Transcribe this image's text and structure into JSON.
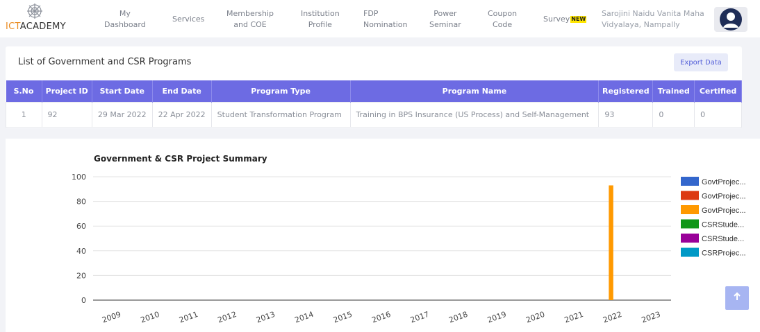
{
  "header": {
    "logo_text": "ICTACADEMY",
    "logo_prefix": "ICT",
    "logo_suffix": "ACADEMY",
    "nav": [
      {
        "label": "My\nDashboard"
      },
      {
        "label": "Services"
      },
      {
        "label": "Membership\nand COE"
      },
      {
        "label": "Institution\nProfile"
      },
      {
        "label": "FDP\nNomination"
      },
      {
        "label": "Power\nSeminar"
      },
      {
        "label": "Coupon\nCode"
      },
      {
        "label": "Survey",
        "badge": "NEW"
      }
    ],
    "college": "Sarojini Naidu Vanita Maha\nVidyalaya, Nampally",
    "avatar_icon": "user-circle-icon"
  },
  "programs": {
    "title": "List of Government and CSR Programs",
    "export_label": "Export Data",
    "columns": [
      "S.No",
      "Project ID",
      "Start Date",
      "End Date",
      "Program Type",
      "Program Name",
      "Registered",
      "Trained",
      "Certified"
    ],
    "rows": [
      [
        "1",
        "92",
        "29 Mar 2022",
        "22 Apr 2022",
        "Student Transformation Program",
        "Training in BPS Insurance (US Process) and Self-Management",
        "93",
        "0",
        "0"
      ]
    ],
    "header_color": "#6d6be3"
  },
  "chart_data": {
    "type": "bar",
    "title": "Government & CSR Project Summary",
    "categories": [
      "2009",
      "2010",
      "2011",
      "2012",
      "2013",
      "2014",
      "2015",
      "2016",
      "2017",
      "2018",
      "2019",
      "2020",
      "2021",
      "2022",
      "2023"
    ],
    "ylim": [
      0,
      100
    ],
    "yticks": [
      0,
      20,
      40,
      60,
      80,
      100
    ],
    "grid": true,
    "legend_position": "right",
    "series": [
      {
        "name": "GovtProjec...",
        "color": "#3366cc",
        "values": [
          0,
          0,
          0,
          0,
          0,
          0,
          0,
          0,
          0,
          0,
          0,
          0,
          0,
          0,
          0
        ]
      },
      {
        "name": "GovtProjec...",
        "color": "#dc3912",
        "values": [
          0,
          0,
          0,
          0,
          0,
          0,
          0,
          0,
          0,
          0,
          0,
          0,
          0,
          0,
          0
        ]
      },
      {
        "name": "GovtProjec...",
        "color": "#ff9900",
        "values": [
          0,
          0,
          0,
          0,
          0,
          0,
          0,
          0,
          0,
          0,
          0,
          0,
          0,
          93,
          0
        ]
      },
      {
        "name": "CSRStude...",
        "color": "#109618",
        "values": [
          0,
          0,
          0,
          0,
          0,
          0,
          0,
          0,
          0,
          0,
          0,
          0,
          0,
          0,
          0
        ]
      },
      {
        "name": "CSRStude...",
        "color": "#990099",
        "values": [
          0,
          0,
          0,
          0,
          0,
          0,
          0,
          0,
          0,
          0,
          0,
          0,
          0,
          0,
          0
        ]
      },
      {
        "name": "CSRProjec...",
        "color": "#0099c6",
        "values": [
          0,
          0,
          0,
          0,
          0,
          0,
          0,
          0,
          0,
          0,
          0,
          0,
          0,
          0,
          0
        ]
      }
    ]
  },
  "scroll_top_icon": "arrow-up-icon"
}
